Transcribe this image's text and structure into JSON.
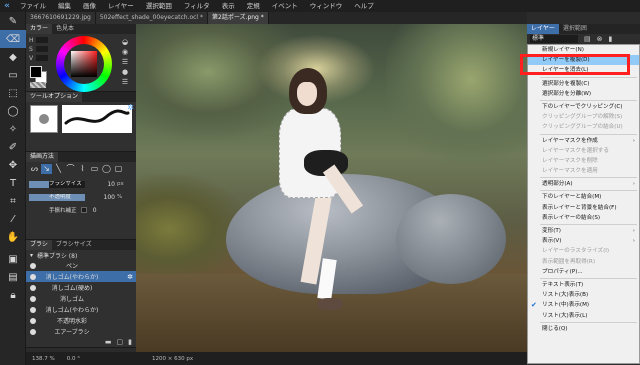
{
  "menubar": {
    "items": [
      "ファイル",
      "編集",
      "画像",
      "レイヤー",
      "選択範囲",
      "フィルタ",
      "表示",
      "定規",
      "イベント",
      "ウィンドウ",
      "ヘルプ"
    ]
  },
  "tabs": [
    {
      "label": "3667610691229.jpg",
      "active": false
    },
    {
      "label": "502effect_shade_00eyecatch.ocl *",
      "active": false
    },
    {
      "label": "第2話ポーズ.png *",
      "active": true
    }
  ],
  "color_panel": {
    "tabs": [
      "カラー",
      "色見本"
    ],
    "hsv": [
      {
        "label": "H",
        "value": "0"
      },
      {
        "label": "S",
        "value": "0"
      },
      {
        "label": "V",
        "value": "0"
      }
    ]
  },
  "tool_option_panel": {
    "title": "ツールオプション"
  },
  "draw_method_panel": {
    "title": "描画方法",
    "brush_size": {
      "label": "ブラシサイズ",
      "value": "10",
      "unit": "px",
      "fraction": 0.35
    },
    "opacity": {
      "label": "不透明度",
      "value": "100",
      "unit": "%",
      "fraction": 1.0
    },
    "stabilizer": {
      "label": "手振れ補正",
      "value": "0"
    }
  },
  "brush_panel": {
    "tabs": [
      "ブラシ",
      "ブラシサイズ"
    ],
    "group": "標準ブラシ (8)",
    "items": [
      {
        "name": "ペン",
        "selected": false
      },
      {
        "name": "消しゴム(やわらか)",
        "selected": true
      },
      {
        "name": "消しゴム(硬め)",
        "selected": false
      },
      {
        "name": "消しゴム",
        "selected": false
      },
      {
        "name": "消しゴム(やわらか)",
        "selected": false
      },
      {
        "name": "不透明水彩",
        "selected": false
      },
      {
        "name": "エアーブラシ",
        "selected": false
      }
    ]
  },
  "statusbar": {
    "zoom": "138.7 %",
    "angle": "0.0 °",
    "size": "1200 × 630 px"
  },
  "right_panel": {
    "tabs": [
      "レイヤー",
      "選択範囲"
    ],
    "blend_mode": "標準"
  },
  "context_menu": {
    "items": [
      {
        "label": "新規レイヤー(N)",
        "disabled": false,
        "arrow": false
      },
      {
        "label": "レイヤーを複製(D)",
        "disabled": false,
        "highlight": true
      },
      {
        "label": "レイヤーを消去(L)",
        "disabled": false
      },
      {
        "sep": true
      },
      {
        "label": "選択部分を複製(C)",
        "disabled": false
      },
      {
        "label": "選択部分を分離(W)",
        "disabled": false
      },
      {
        "sep": true
      },
      {
        "label": "下のレイヤーでクリッピング(C)",
        "disabled": false
      },
      {
        "label": "クリッピンググループの解除(S)",
        "disabled": true
      },
      {
        "label": "クリッピンググループの結合(U)",
        "disabled": true
      },
      {
        "sep": true
      },
      {
        "label": "レイヤーマスクを作成",
        "disabled": false,
        "arrow": true
      },
      {
        "label": "レイヤーマスクを選択する",
        "disabled": true
      },
      {
        "label": "レイヤーマスクを削除",
        "disabled": true
      },
      {
        "label": "レイヤーマスクを適用",
        "disabled": true
      },
      {
        "sep": true
      },
      {
        "label": "透明部分(A)",
        "disabled": false,
        "arrow": true
      },
      {
        "sep": true
      },
      {
        "label": "下のレイヤーと結合(M)",
        "disabled": false
      },
      {
        "label": "表示レイヤーと背景を結合(F)",
        "disabled": false
      },
      {
        "label": "表示レイヤーの結合(S)",
        "disabled": false
      },
      {
        "sep": true
      },
      {
        "label": "変形(T)",
        "disabled": false,
        "arrow": true
      },
      {
        "label": "表示(V)",
        "disabled": false,
        "arrow": true
      },
      {
        "label": "レイヤーのラスタライズ(I)",
        "disabled": true
      },
      {
        "label": "表示範囲を再取得(R)",
        "disabled": true
      },
      {
        "label": "プロパティ(P)...",
        "disabled": false
      },
      {
        "sep": true
      },
      {
        "label": "テキスト表示(T)",
        "disabled": false
      },
      {
        "label": "リスト(大)表示(B)",
        "disabled": false
      },
      {
        "label": "リスト(中)表示(M)",
        "disabled": false,
        "checked": true
      },
      {
        "label": "リスト(大)表示(L)",
        "disabled": false
      },
      {
        "sep": true
      },
      {
        "label": "閉じる(Q)",
        "disabled": false
      }
    ]
  }
}
